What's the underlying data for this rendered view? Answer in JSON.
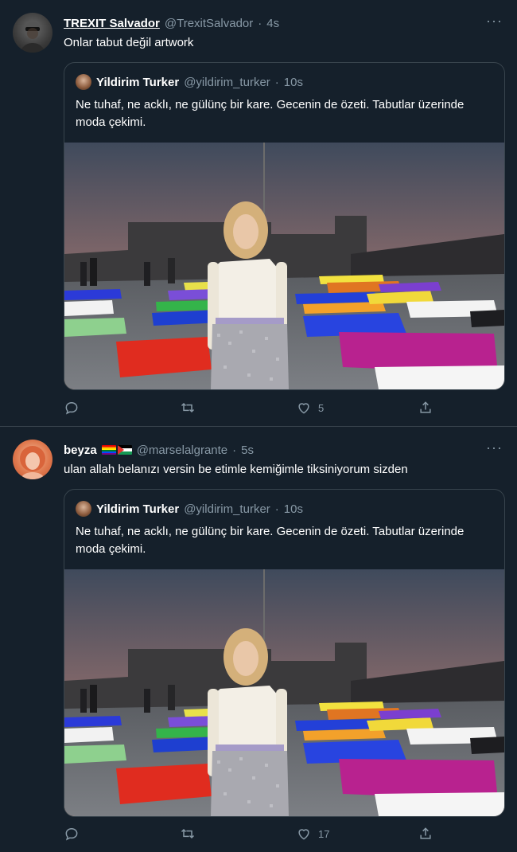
{
  "tweets": [
    {
      "name": "TREXIT Salvador",
      "handle": "@TrexitSalvador",
      "separator": "·",
      "time": "4s",
      "text": "Onlar tabut değil artwork",
      "quote": {
        "name": "Yildirim Turker",
        "handle": "@yildirim_turker",
        "separator": "·",
        "time": "10s",
        "text": "Ne tuhaf, ne acklı, ne gülünç bir kare. Gecenin de özeti. Tabutlar üzerinde moda çekimi."
      },
      "actions": {
        "reply_count": "",
        "retweet_count": "",
        "like_count": "5"
      }
    },
    {
      "name": "beyza",
      "handle": "@marselalgrante",
      "separator": "·",
      "time": "5s",
      "text": "ulan allah belanızı versin be etimle kemiğimle tiksiniyorum sizden",
      "quote": {
        "name": "Yildirim Turker",
        "handle": "@yildirim_turker",
        "separator": "·",
        "time": "10s",
        "text": "Ne tuhaf, ne acklı, ne gülünç bir kare. Gecenin de özeti. Tabutlar üzerinde moda çekimi."
      },
      "actions": {
        "reply_count": "",
        "retweet_count": "",
        "like_count": "17"
      }
    }
  ],
  "more_glyph": "···",
  "colors": {
    "background": "#15202b",
    "border": "#38444d",
    "muted": "#8899a6",
    "text": "#ffffff"
  },
  "icons": [
    "reply-icon",
    "retweet-icon",
    "like-icon",
    "share-icon",
    "more-icon",
    "flag-rainbow-icon",
    "flag-palestine-icon"
  ]
}
